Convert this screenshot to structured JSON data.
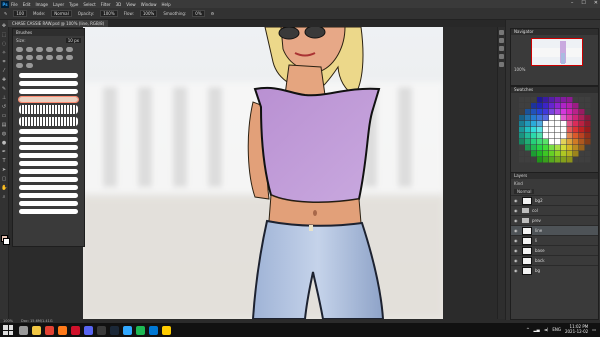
{
  "menu": {
    "app_icon": "photoshop-icon",
    "items": [
      "File",
      "Edit",
      "Image",
      "Layer",
      "Type",
      "Select",
      "Filter",
      "3D",
      "View",
      "Window",
      "Help"
    ],
    "window_controls": [
      "minimize",
      "maximize",
      "close"
    ]
  },
  "options": {
    "size": "100",
    "mode_label": "Mode:",
    "mode_value": "Normal",
    "opacity_label": "Opacity:",
    "opacity_value": "100%",
    "flow_label": "Flow:",
    "flow_value": "100%",
    "smoothing_label": "Smoothing:",
    "smoothing_value": "0%"
  },
  "document": {
    "tab_title": "CHASE CASSIE RAW.psd @ 100% (line, RGB/8)"
  },
  "brushes_panel": {
    "title": "Brushes",
    "size_label": "Size:",
    "size_value": "10 px",
    "stroke_count": 17,
    "selected_index": 3
  },
  "navigator": {
    "title": "Navigator",
    "zoom": "100%"
  },
  "swatches": {
    "title": "Swatches"
  },
  "layers": {
    "title": "Layers",
    "kind_label": "Kind",
    "blend_mode": "Normal",
    "rows": [
      {
        "name": "bg2",
        "type": "layer",
        "visible": true,
        "active": false
      },
      {
        "name": "col",
        "type": "folder",
        "visible": true,
        "active": false
      },
      {
        "name": "prev",
        "type": "folder",
        "visible": true,
        "active": false
      },
      {
        "name": "line",
        "type": "layer",
        "visible": true,
        "active": true
      },
      {
        "name": "li",
        "type": "layer",
        "visible": true,
        "active": false
      },
      {
        "name": "base",
        "type": "layer",
        "visible": true,
        "active": false
      },
      {
        "name": "back",
        "type": "layer",
        "visible": true,
        "active": false
      },
      {
        "name": "bg",
        "type": "layer",
        "visible": true,
        "active": false
      }
    ]
  },
  "status": {
    "zoom": "100%",
    "doc": "Doc: 15.6M/1.41G"
  },
  "taskbar": {
    "time": "11:02 PM",
    "date": "2021-12-02",
    "language": "ENG",
    "apps": [
      {
        "name": "search-icon",
        "color": "#9a9a9a"
      },
      {
        "name": "file-explorer-icon",
        "color": "#f2c744"
      },
      {
        "name": "chrome-icon",
        "color": "#e34133"
      },
      {
        "name": "firefox-icon",
        "color": "#ff7a1a"
      },
      {
        "name": "opera-icon",
        "color": "#d0112b"
      },
      {
        "name": "discord-icon",
        "color": "#5865f2"
      },
      {
        "name": "obs-icon",
        "color": "#3a3a3a"
      },
      {
        "name": "steam-icon",
        "color": "#1b2838"
      },
      {
        "name": "photoshop-icon",
        "color": "#31a8ff"
      },
      {
        "name": "spotify-icon",
        "color": "#1db954"
      },
      {
        "name": "mail-icon",
        "color": "#0078d4"
      },
      {
        "name": "notes-icon",
        "color": "#ffcc00"
      }
    ]
  }
}
